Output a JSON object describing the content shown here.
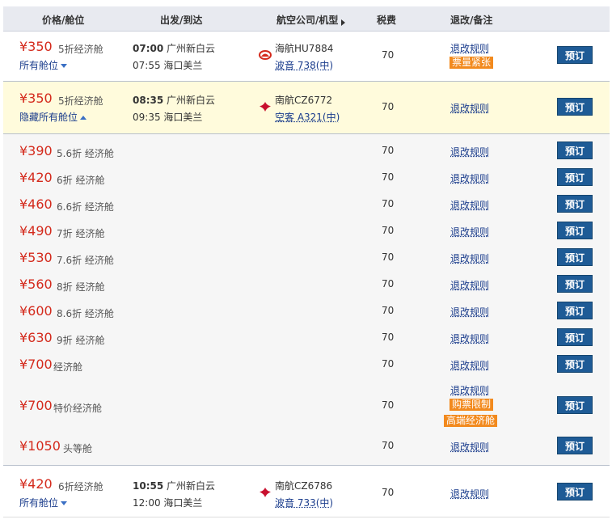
{
  "header": {
    "price_cabin": "价格/舱位",
    "dep_arr": "出发/到达",
    "airline_type": "航空公司/机型",
    "tax": "税费",
    "rules": "退改/备注"
  },
  "flights": [
    {
      "price": "¥350",
      "cabin": "5折经济舱",
      "toggle": "所有舱位",
      "dep_time": "07:00",
      "dep_airport": "广州新白云",
      "arr_time": "07:55",
      "arr_airport": "海口美兰",
      "airline": "海航HU7884",
      "plane": "波音 738(中)",
      "tax": "70",
      "rule": "退改规则",
      "badge": "票量紧张",
      "book": "预订"
    },
    {
      "price": "¥350",
      "cabin": "5折经济舱",
      "toggle": "隐藏所有舱位",
      "dep_time": "08:35",
      "dep_airport": "广州新白云",
      "arr_time": "09:35",
      "arr_airport": "海口美兰",
      "airline": "南航CZ6772",
      "plane": "空客 A321(中)",
      "tax": "70",
      "rule": "退改规则",
      "book": "预订"
    },
    {
      "price": "¥420",
      "cabin": "6折经济舱",
      "toggle": "所有舱位",
      "dep_time": "10:55",
      "dep_airport": "广州新白云",
      "arr_time": "12:00",
      "arr_airport": "海口美兰",
      "airline": "南航CZ6786",
      "plane": "波音 733(中)",
      "tax": "70",
      "rule": "退改规则",
      "book": "预订"
    }
  ],
  "sub_rows": [
    {
      "price": "¥390",
      "cabin": "5.6折 经济舱",
      "tax": "70",
      "rule": "退改规则",
      "book": "预订"
    },
    {
      "price": "¥420",
      "cabin": "6折 经济舱",
      "tax": "70",
      "rule": "退改规则",
      "book": "预订"
    },
    {
      "price": "¥460",
      "cabin": "6.6折 经济舱",
      "tax": "70",
      "rule": "退改规则",
      "book": "预订"
    },
    {
      "price": "¥490",
      "cabin": "7折 经济舱",
      "tax": "70",
      "rule": "退改规则",
      "book": "预订"
    },
    {
      "price": "¥530",
      "cabin": "7.6折 经济舱",
      "tax": "70",
      "rule": "退改规则",
      "book": "预订"
    },
    {
      "price": "¥560",
      "cabin": "8折 经济舱",
      "tax": "70",
      "rule": "退改规则",
      "book": "预订"
    },
    {
      "price": "¥600",
      "cabin": "8.6折 经济舱",
      "tax": "70",
      "rule": "退改规则",
      "book": "预订"
    },
    {
      "price": "¥630",
      "cabin": "9折 经济舱",
      "tax": "70",
      "rule": "退改规则",
      "book": "预订"
    },
    {
      "price": "¥700",
      "cabin": "经济舱",
      "tax": "70",
      "rule": "退改规则",
      "book": "预订"
    },
    {
      "price": "¥700",
      "cabin": "特价经济舱",
      "tax": "70",
      "rule": "退改规则",
      "badge1": "购票限制",
      "badge2": "高端经济舱",
      "book": "预订"
    },
    {
      "price": "¥1050",
      "cabin": "头等舱",
      "tax": "70",
      "rule": "退改规则",
      "book": "预订"
    }
  ],
  "colors": {
    "price": "#d42a1c",
    "book_button": "#1e5b96",
    "badge": "#f28a1e",
    "highlight": "#fffbdc"
  },
  "icons": {
    "hainan_logo": "hainan-airlines-logo",
    "csair_logo": "china-southern-logo"
  }
}
